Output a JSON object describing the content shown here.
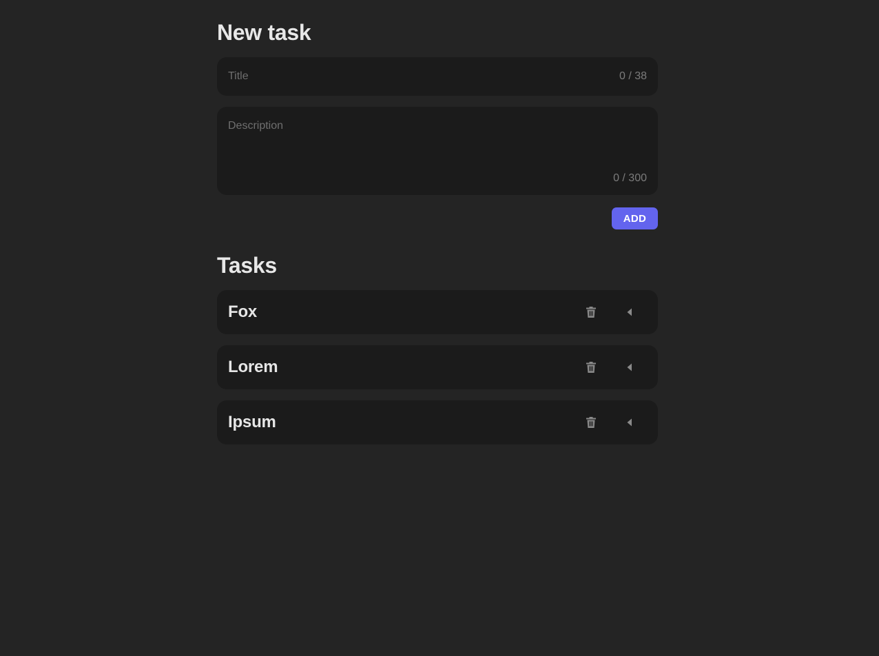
{
  "new_task": {
    "heading": "New task",
    "title_field": {
      "placeholder": "Title",
      "value": "",
      "counter": "0 / 38"
    },
    "description_field": {
      "placeholder": "Description",
      "value": "",
      "counter": "0 / 300"
    },
    "add_label": "ADD"
  },
  "tasks": {
    "heading": "Tasks",
    "items": [
      {
        "title": "Fox",
        "delete_icon": "trash-icon",
        "toggle_icon": "caret-left-icon"
      },
      {
        "title": "Lorem",
        "delete_icon": "trash-icon",
        "toggle_icon": "caret-left-icon"
      },
      {
        "title": "Ipsum",
        "delete_icon": "trash-icon",
        "toggle_icon": "caret-left-icon"
      }
    ]
  },
  "colors": {
    "background": "#242424",
    "card": "#1b1b1b",
    "accent": "#6364ee",
    "icon": "#8a8a8a"
  }
}
